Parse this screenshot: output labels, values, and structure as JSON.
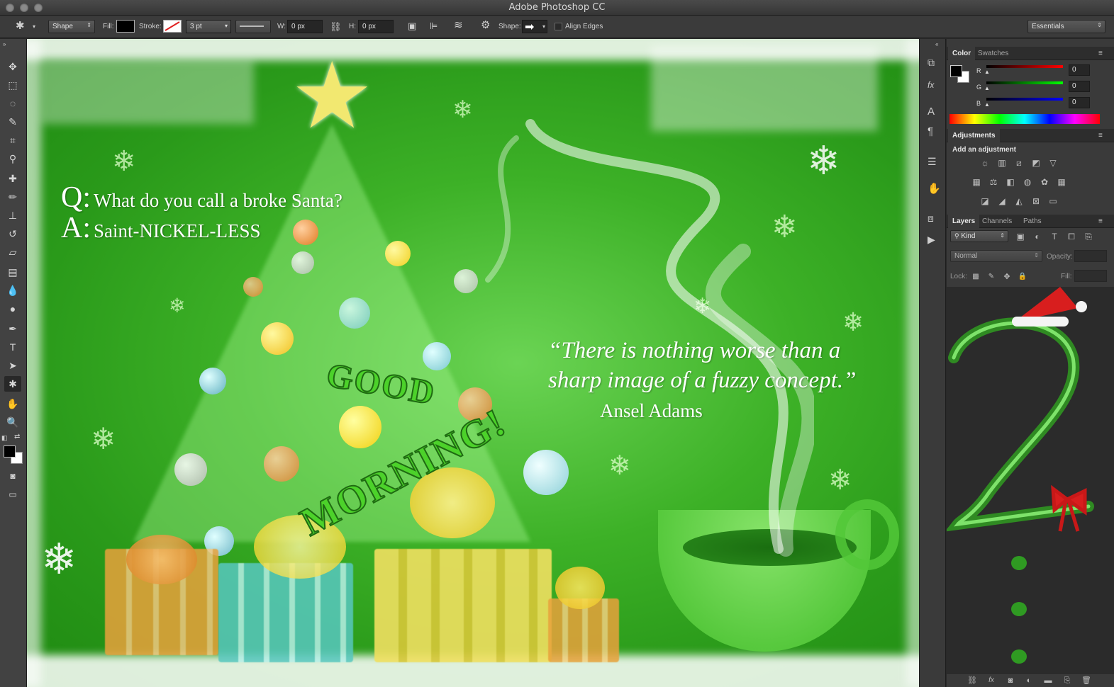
{
  "app": {
    "title": "Adobe Photoshop CC"
  },
  "options": {
    "mode": "Shape",
    "fill_label": "Fill:",
    "stroke_label": "Stroke:",
    "stroke_width": "3 pt",
    "w_label": "W:",
    "w_value": "0 px",
    "h_label": "H:",
    "h_value": "0 px",
    "shape_label": "Shape:",
    "align_edges_label": "Align Edges",
    "workspace": "Essentials"
  },
  "colors": {
    "accent": "#3ab41f",
    "panel": "#3a3a3a",
    "fg_color": "#000000",
    "bg_color": "#ffffff"
  },
  "tools": [
    "move-icon",
    "marquee-icon",
    "lasso-icon",
    "quick-select-icon",
    "crop-icon",
    "eyedropper-icon",
    "healing-icon",
    "brush-icon",
    "stamp-icon",
    "history-brush-icon",
    "eraser-icon",
    "gradient-icon",
    "blur-icon",
    "dodge-icon",
    "pen-icon",
    "type-icon",
    "path-select-icon",
    "custom-shape-icon",
    "hand-icon",
    "zoom-icon"
  ],
  "canvas": {
    "q_letter": "Q:",
    "q_text": "What do you call a broke Santa?",
    "a_letter": "A:",
    "a_text": "Saint-NICKEL-LESS",
    "quote_line1": "“There is nothing worse than a",
    "quote_line2": "sharp image of a fuzzy concept.”",
    "quote_author": "Ansel Adams",
    "greeting_1": "GOOD",
    "greeting_2": "MORNING!"
  },
  "color_panel": {
    "tabs": [
      "Color",
      "Swatches"
    ],
    "channels": [
      {
        "label": "R",
        "value": "0"
      },
      {
        "label": "G",
        "value": "0"
      },
      {
        "label": "B",
        "value": "0"
      }
    ]
  },
  "adjustments_panel": {
    "tab": "Adjustments",
    "heading": "Add an adjustment"
  },
  "layers_panel": {
    "tabs": [
      "Layers",
      "Channels",
      "Paths"
    ],
    "filter_kind": "Kind",
    "blend_mode": "Normal",
    "opacity_label": "Opacity:",
    "lock_label": "Lock:",
    "fill_label": "Fill:"
  }
}
